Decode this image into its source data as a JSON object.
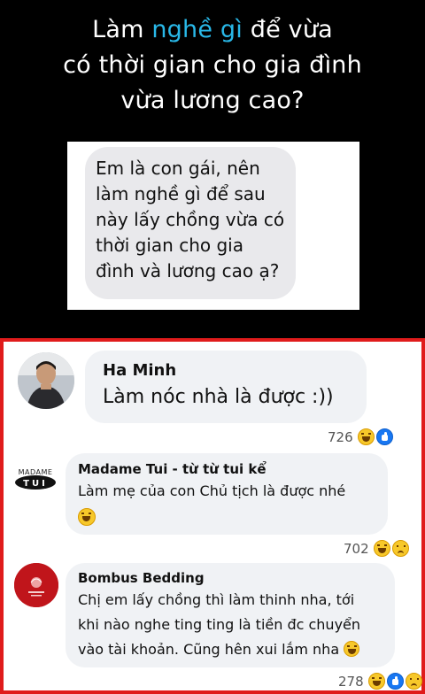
{
  "headline": {
    "line1_pre": "Làm ",
    "line1_highlight": "nghề gì",
    "line1_post": " để vừa",
    "line2": "có thời gian cho gia đình",
    "line3": "vừa lương cao?",
    "highlight_color": "#29b8e8"
  },
  "question": {
    "lines": [
      "Em là con gái, nên",
      "làm nghề gì để sau",
      "này lấy chồng vừa có",
      "thời gian cho gia",
      "đình và lương cao ạ?"
    ]
  },
  "comments": [
    {
      "name": "Ha Minh",
      "text": "Làm nóc nhà là được :))",
      "reactions_count": "726",
      "reactions": [
        "haha-icon",
        "like-icon"
      ]
    },
    {
      "name": "Madame Tui - từ từ tui kể",
      "avatar_text": "MADAME TUI",
      "text": "Làm mẹ của con Chủ tịch là được nhé",
      "reactions_count": "702",
      "reactions": [
        "haha-icon",
        "sad-icon"
      ]
    },
    {
      "name": "Bombus Bedding",
      "lines": [
        "Chị em lấy chồng thì làm thinh nha, tới",
        "khi nào nghe ting ting là tiền đc chuyển",
        "vào tài khoản. Cũng hên xui lắm nha"
      ],
      "reactions_count": "278",
      "reactions": [
        "haha-icon",
        "like-icon",
        "sad-icon"
      ]
    }
  ],
  "colors": {
    "frame_border": "#e01b1b",
    "bubble_bg": "#f0f2f5"
  }
}
